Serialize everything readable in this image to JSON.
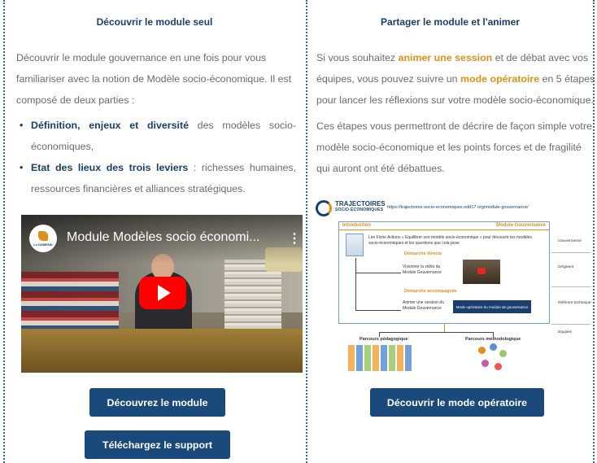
{
  "left": {
    "title": "Découvrir le module seul",
    "intro_line1": "Découvrir le module gouvernance en une fois pour vous",
    "intro_line2": "familiariser avec la notion de Modèle socio-économique. Il est",
    "intro_line3": "composé de deux parties :",
    "bullets": [
      {
        "strong": "Définition, enjeux et diversité",
        "rest": " des modèles socio-économiques,"
      },
      {
        "strong": "Etat des lieux des trois leviers",
        "rest": " : richesses humaines, ressources financières et alliances stratégiques."
      }
    ],
    "video": {
      "title": "Module Modèles socio économi...",
      "channel_logo_text": "Le DAMEND",
      "menu_glyph": "⋮"
    },
    "btn_module": "Découvrez le module",
    "btn_support": "Téléchargez le support"
  },
  "right": {
    "title": "Partager le module et l'animer",
    "p1_a": "Si vous souhaitez ",
    "p1_b": "animer une session",
    "p1_c": " et de débat avec vos",
    "p1_d": "équipes, vous pouvez suivre un ",
    "p1_e": "mode opératoire",
    "p1_f": " en 5 étapes",
    "p1_g": "pour lancer les réflexions sur votre modèle socio-économique.",
    "p2_line1": "Ces étapes vous permettront de décrire de façon simple votre",
    "p2_line2": "modèle socio-économique et les points forces et de fragilité",
    "p2_line3": "qui auront ont été débattues.",
    "diagram": {
      "brand1": "TRAJECTOIRES",
      "brand2": "SOCIO-ÉCONOMIQUES",
      "url": "https://trajectoires-socio-economiques.odd17.org/module-gouvernance/",
      "hdr_left": "Introduction",
      "hdr_right": "Module Gouvernance",
      "step1": "Lire Fiche Actions « Equilibrer son modèle socio-économique » pour découvrir les modèles socio-économiques et les questions que cela pose",
      "direct": "Démarche directe",
      "step2": "Visionner la vidéo du Module Gouvernance",
      "accomp": "Démarche accompagnée",
      "step3": "Animer une session du Module Gouvernance",
      "navy_box": "Mode opératoire du module de gouvernance",
      "side1": "Gouvernance",
      "side2": "Dirigeant",
      "side3": "Référent technique",
      "side4": "Equipes",
      "parcours1": "Parcours pédagogique",
      "parcours2": "Parcours méthodologique"
    },
    "btn_mode": "Découvrir le mode opératoire"
  },
  "colors": {
    "navy": "#1a3e6e",
    "orange": "#e0901a",
    "button": "#1a4a7c",
    "youtube_red": "#ff0000"
  }
}
